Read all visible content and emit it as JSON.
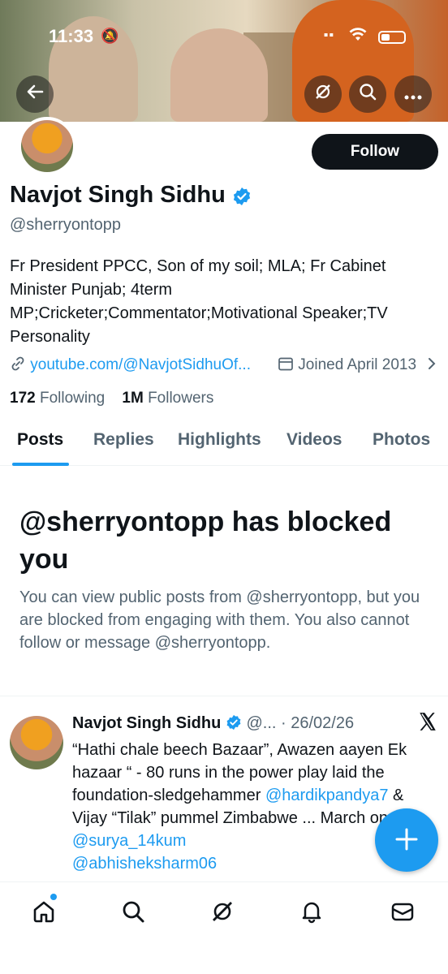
{
  "status_bar": {
    "time": "11:33"
  },
  "banner": {
    "accent": "#c4622a"
  },
  "profile": {
    "follow_label": "Follow",
    "name": "Navjot Singh Sidhu",
    "handle": "@sherryontopp",
    "bio": "Fr President PPCC, Son of my soil; MLA; Fr Cabinet Minister Punjab; 4term MP;Cricketer;Commentator;Motivational Speaker;TV Personality",
    "link": "youtube.com/@NavjotSidhuOf...",
    "joined": "Joined April 2013",
    "following_count": "172",
    "following_label": "Following",
    "followers_count": "1M",
    "followers_label": "Followers"
  },
  "tabs": [
    {
      "label": "Posts",
      "active": true
    },
    {
      "label": "Replies"
    },
    {
      "label": "Highlights"
    },
    {
      "label": "Videos"
    },
    {
      "label": "Photos"
    }
  ],
  "blocked": {
    "title": "@sherryontopp has blocked you",
    "text": "You can view public posts from @sherryontopp, but you are blocked from engaging with them. You also cannot follow or message @sherryontopp."
  },
  "post": {
    "author": "Navjot Singh Sidhu",
    "handle_trunc": "@...",
    "date": "· 26/02/26",
    "line1": "“Hathi chale beech Bazaar”, Awazen aayen Ek hazaar “ - 80 runs in the power play laid the foundation-sledgehammer",
    "mention1": "@hardikpandya7",
    "line2": " & Vijay “Tilak” pummel Zimbabwe  ... March on ",
    "mention2": "@surya_14kum",
    "mention3": "@abhisheksharm06"
  },
  "colors": {
    "accent": "#1d9bf0",
    "text": "#0f1419",
    "muted": "#536471"
  }
}
